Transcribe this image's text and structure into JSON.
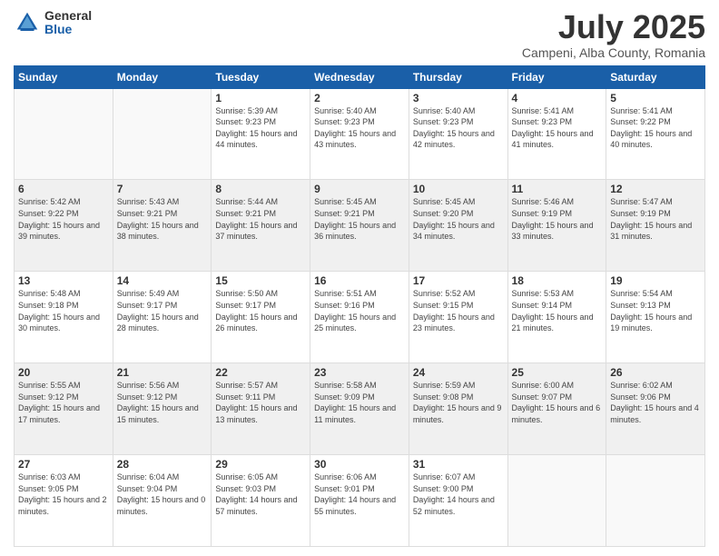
{
  "logo": {
    "general": "General",
    "blue": "Blue"
  },
  "header": {
    "title": "July 2025",
    "subtitle": "Campeni, Alba County, Romania"
  },
  "days_of_week": [
    "Sunday",
    "Monday",
    "Tuesday",
    "Wednesday",
    "Thursday",
    "Friday",
    "Saturday"
  ],
  "weeks": [
    [
      {
        "day": "",
        "info": ""
      },
      {
        "day": "",
        "info": ""
      },
      {
        "day": "1",
        "info": "Sunrise: 5:39 AM\nSunset: 9:23 PM\nDaylight: 15 hours and 44 minutes."
      },
      {
        "day": "2",
        "info": "Sunrise: 5:40 AM\nSunset: 9:23 PM\nDaylight: 15 hours and 43 minutes."
      },
      {
        "day": "3",
        "info": "Sunrise: 5:40 AM\nSunset: 9:23 PM\nDaylight: 15 hours and 42 minutes."
      },
      {
        "day": "4",
        "info": "Sunrise: 5:41 AM\nSunset: 9:23 PM\nDaylight: 15 hours and 41 minutes."
      },
      {
        "day": "5",
        "info": "Sunrise: 5:41 AM\nSunset: 9:22 PM\nDaylight: 15 hours and 40 minutes."
      }
    ],
    [
      {
        "day": "6",
        "info": "Sunrise: 5:42 AM\nSunset: 9:22 PM\nDaylight: 15 hours and 39 minutes."
      },
      {
        "day": "7",
        "info": "Sunrise: 5:43 AM\nSunset: 9:21 PM\nDaylight: 15 hours and 38 minutes."
      },
      {
        "day": "8",
        "info": "Sunrise: 5:44 AM\nSunset: 9:21 PM\nDaylight: 15 hours and 37 minutes."
      },
      {
        "day": "9",
        "info": "Sunrise: 5:45 AM\nSunset: 9:21 PM\nDaylight: 15 hours and 36 minutes."
      },
      {
        "day": "10",
        "info": "Sunrise: 5:45 AM\nSunset: 9:20 PM\nDaylight: 15 hours and 34 minutes."
      },
      {
        "day": "11",
        "info": "Sunrise: 5:46 AM\nSunset: 9:19 PM\nDaylight: 15 hours and 33 minutes."
      },
      {
        "day": "12",
        "info": "Sunrise: 5:47 AM\nSunset: 9:19 PM\nDaylight: 15 hours and 31 minutes."
      }
    ],
    [
      {
        "day": "13",
        "info": "Sunrise: 5:48 AM\nSunset: 9:18 PM\nDaylight: 15 hours and 30 minutes."
      },
      {
        "day": "14",
        "info": "Sunrise: 5:49 AM\nSunset: 9:17 PM\nDaylight: 15 hours and 28 minutes."
      },
      {
        "day": "15",
        "info": "Sunrise: 5:50 AM\nSunset: 9:17 PM\nDaylight: 15 hours and 26 minutes."
      },
      {
        "day": "16",
        "info": "Sunrise: 5:51 AM\nSunset: 9:16 PM\nDaylight: 15 hours and 25 minutes."
      },
      {
        "day": "17",
        "info": "Sunrise: 5:52 AM\nSunset: 9:15 PM\nDaylight: 15 hours and 23 minutes."
      },
      {
        "day": "18",
        "info": "Sunrise: 5:53 AM\nSunset: 9:14 PM\nDaylight: 15 hours and 21 minutes."
      },
      {
        "day": "19",
        "info": "Sunrise: 5:54 AM\nSunset: 9:13 PM\nDaylight: 15 hours and 19 minutes."
      }
    ],
    [
      {
        "day": "20",
        "info": "Sunrise: 5:55 AM\nSunset: 9:12 PM\nDaylight: 15 hours and 17 minutes."
      },
      {
        "day": "21",
        "info": "Sunrise: 5:56 AM\nSunset: 9:12 PM\nDaylight: 15 hours and 15 minutes."
      },
      {
        "day": "22",
        "info": "Sunrise: 5:57 AM\nSunset: 9:11 PM\nDaylight: 15 hours and 13 minutes."
      },
      {
        "day": "23",
        "info": "Sunrise: 5:58 AM\nSunset: 9:09 PM\nDaylight: 15 hours and 11 minutes."
      },
      {
        "day": "24",
        "info": "Sunrise: 5:59 AM\nSunset: 9:08 PM\nDaylight: 15 hours and 9 minutes."
      },
      {
        "day": "25",
        "info": "Sunrise: 6:00 AM\nSunset: 9:07 PM\nDaylight: 15 hours and 6 minutes."
      },
      {
        "day": "26",
        "info": "Sunrise: 6:02 AM\nSunset: 9:06 PM\nDaylight: 15 hours and 4 minutes."
      }
    ],
    [
      {
        "day": "27",
        "info": "Sunrise: 6:03 AM\nSunset: 9:05 PM\nDaylight: 15 hours and 2 minutes."
      },
      {
        "day": "28",
        "info": "Sunrise: 6:04 AM\nSunset: 9:04 PM\nDaylight: 15 hours and 0 minutes."
      },
      {
        "day": "29",
        "info": "Sunrise: 6:05 AM\nSunset: 9:03 PM\nDaylight: 14 hours and 57 minutes."
      },
      {
        "day": "30",
        "info": "Sunrise: 6:06 AM\nSunset: 9:01 PM\nDaylight: 14 hours and 55 minutes."
      },
      {
        "day": "31",
        "info": "Sunrise: 6:07 AM\nSunset: 9:00 PM\nDaylight: 14 hours and 52 minutes."
      },
      {
        "day": "",
        "info": ""
      },
      {
        "day": "",
        "info": ""
      }
    ]
  ]
}
